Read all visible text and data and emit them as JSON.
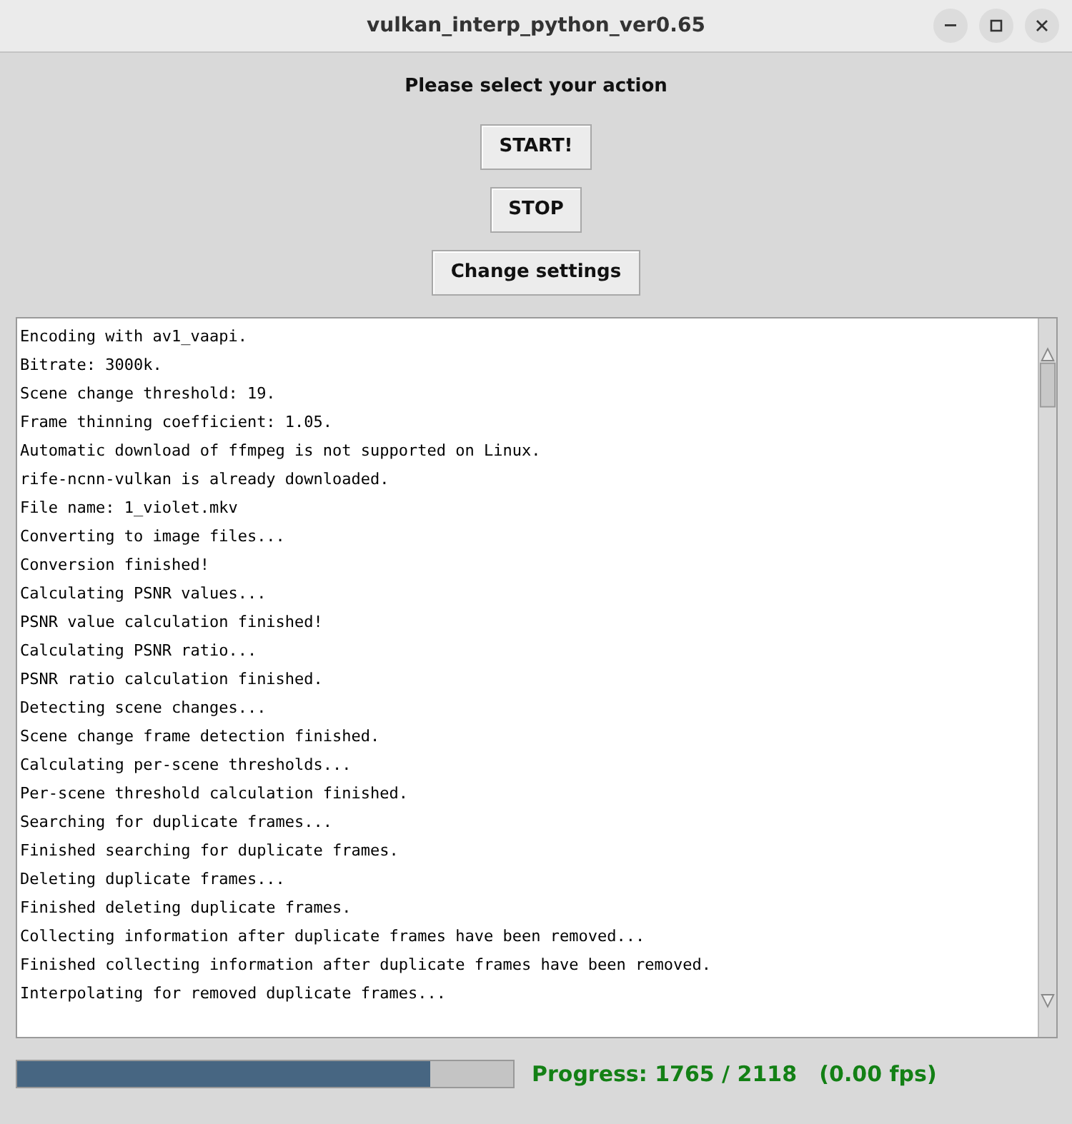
{
  "window": {
    "title": "vulkan_interp_python_ver0.65"
  },
  "prompt": "Please select your action",
  "buttons": [
    "START!",
    "STOP",
    "Change settings"
  ],
  "log": [
    "Encoding with av1_vaapi.",
    "Bitrate: 3000k.",
    "Scene change threshold: 19.",
    "Frame thinning coefficient: 1.05.",
    "Automatic download of ffmpeg is not supported on Linux.",
    "rife-ncnn-vulkan is already downloaded.",
    "File name: 1_violet.mkv",
    "Converting to image files...",
    "Conversion finished!",
    "Calculating PSNR values...",
    "PSNR value calculation finished!",
    "Calculating PSNR ratio...",
    "PSNR ratio calculation finished.",
    "Detecting scene changes...",
    "Scene change frame detection finished.",
    "Calculating per-scene thresholds...",
    "Per-scene threshold calculation finished.",
    "Searching for duplicate frames...",
    "Finished searching for duplicate frames.",
    "Deleting duplicate frames...",
    "Finished deleting duplicate frames.",
    "Collecting information after duplicate frames have been removed...",
    "Finished collecting information after duplicate frames have been removed.",
    "Interpolating for removed duplicate frames..."
  ],
  "progress": {
    "level": 0.833,
    "text": "Progress: 1765 / 2118   (0.00 fps)"
  }
}
